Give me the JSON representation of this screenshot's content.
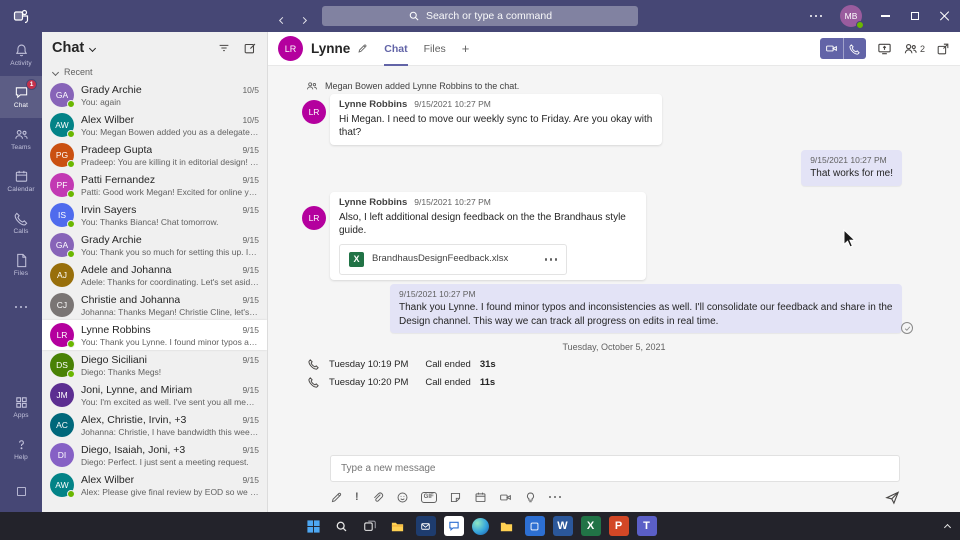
{
  "colors": {
    "accent": "#6264a7",
    "titlebar": "#464775",
    "outgoing_bubble": "#e3e3f6",
    "presence_available": "#6bb700",
    "badge_red": "#c4314b",
    "excel_green": "#217346",
    "word_blue": "#2b579a",
    "powerpoint_orange": "#d24726"
  },
  "titlebar": {
    "search_placeholder": "Search or type a command",
    "user_initials": "MB"
  },
  "rail": {
    "items": [
      {
        "label": "Activity"
      },
      {
        "label": "Chat",
        "badge": "1"
      },
      {
        "label": "Teams"
      },
      {
        "label": "Calendar"
      },
      {
        "label": "Calls"
      },
      {
        "label": "Files"
      }
    ],
    "bottom_items": [
      {
        "label": "Apps"
      },
      {
        "label": "Help"
      }
    ]
  },
  "chat_list": {
    "title": "Chat",
    "section_label": "Recent",
    "items": [
      {
        "name": "Grady Archie",
        "preview": "You: again",
        "date": "10/5",
        "initials": "GA",
        "color": "#8764b8",
        "presence": "available"
      },
      {
        "name": "Alex Wilber",
        "preview": "You: Megan Bowen added you as a delegate. No...",
        "date": "10/5",
        "initials": "AW",
        "color": "#038387",
        "presence": "available"
      },
      {
        "name": "Pradeep Gupta",
        "preview": "Pradeep: You are killing it in editorial design! Tha...",
        "date": "9/15",
        "initials": "PG",
        "color": "#ca5010",
        "presence": "available"
      },
      {
        "name": "Patti Fernandez",
        "preview": "Patti: Good work Megan! Excited for online yoga!...",
        "date": "9/15",
        "initials": "PF",
        "color": "#c239b3",
        "presence": "available"
      },
      {
        "name": "Irvin Sayers",
        "preview": "You: Thanks Bianca! Chat tomorrow.",
        "date": "9/15",
        "initials": "IS",
        "color": "#4f6bed",
        "presence": "available"
      },
      {
        "name": "Grady Archie",
        "preview": "You: Thank you so much for setting this up. I app...",
        "date": "9/15",
        "initials": "GA",
        "color": "#8764b8",
        "presence": "available"
      },
      {
        "name": "Adele and Johanna",
        "preview": "Adele: Thanks for coordinating. Let's set aside at ...",
        "date": "9/15",
        "initials": "AJ",
        "color": "#986f0b"
      },
      {
        "name": "Christie and Johanna",
        "preview": "Johanna: Thanks Megan! Christie Cline, let's jum...",
        "date": "9/15",
        "initials": "CJ",
        "color": "#7a7574"
      },
      {
        "name": "Lynne Robbins",
        "preview": "You: Thank you Lynne. I found minor typos and i...",
        "date": "9/15",
        "initials": "LR",
        "color": "#b4009e",
        "presence": "available",
        "selected": true
      },
      {
        "name": "Diego Siciliani",
        "preview": "Diego: Thanks Megs!",
        "date": "9/15",
        "initials": "DS",
        "color": "#498205",
        "presence": "available"
      },
      {
        "name": "Joni, Lynne, and Miriam",
        "preview": "You: I'm excited as well. I've sent you all meeting ...",
        "date": "9/15",
        "initials": "JM",
        "color": "#5c2e91"
      },
      {
        "name": "Alex, Christie, Irvin, +3",
        "preview": "Johanna: Christie, I have bandwidth this week. Sh...",
        "date": "9/15",
        "initials": "AC",
        "color": "#00687b"
      },
      {
        "name": "Diego, Isaiah, Joni, +3",
        "preview": "Diego: Perfect. I just sent a meeting request.",
        "date": "9/15",
        "initials": "DI",
        "color": "#8661c5"
      },
      {
        "name": "Alex Wilber",
        "preview": "Alex: Please give final review by EOD so we can p...",
        "date": "9/15",
        "initials": "AW",
        "color": "#038387",
        "presence": "available"
      }
    ]
  },
  "conversation": {
    "title": "Lynne",
    "avatar_initials": "LR",
    "tab_chat": "Chat",
    "tab_files": "Files",
    "add_tab": "+",
    "participant_count": "2",
    "system_message": "Megan Bowen added Lynne Robbins to the chat.",
    "m1": {
      "author": "Lynne Robbins",
      "time": "9/15/2021 10:27 PM",
      "text": "Hi Megan. I need to move our weekly sync to Friday. Are you okay with that?"
    },
    "m2": {
      "time": "9/15/2021 10:27 PM",
      "text": "That works for me!"
    },
    "m3": {
      "author": "Lynne Robbins",
      "time": "9/15/2021 10:27 PM",
      "text": "Also, I left additional design feedback on the the Brandhaus style guide.",
      "file_name": "BrandhausDesignFeedback.xlsx",
      "file_type": "X"
    },
    "m4": {
      "time": "9/15/2021 10:27 PM",
      "text": "Thank you Lynne. I found minor typos and inconsistencies as well. I'll consolidate our feedback and share in the Design channel. This way we can track all progress on edits in real time."
    },
    "date_divider": "Tuesday, October 5, 2021",
    "call1": {
      "time": "Tuesday 10:19 PM",
      "status": "Call ended",
      "duration": "31s"
    },
    "call2": {
      "time": "Tuesday 10:20 PM",
      "status": "Call ended",
      "duration": "11s"
    }
  },
  "compose": {
    "placeholder": "Type a new message",
    "gif_label": "GIF"
  },
  "taskbar": {
    "apps": [
      {
        "label": "Start"
      },
      {
        "label": "Search"
      },
      {
        "label": "Task View"
      },
      {
        "label": "File Explorer"
      },
      {
        "label": "App"
      },
      {
        "label": "Chat"
      },
      {
        "label": "Edge"
      },
      {
        "label": "Folder"
      },
      {
        "label": "App"
      },
      {
        "label": "Word",
        "letter": "W"
      },
      {
        "label": "Excel",
        "letter": "X"
      },
      {
        "label": "PowerPoint",
        "letter": "P"
      },
      {
        "label": "Teams",
        "letter": "T"
      }
    ]
  }
}
